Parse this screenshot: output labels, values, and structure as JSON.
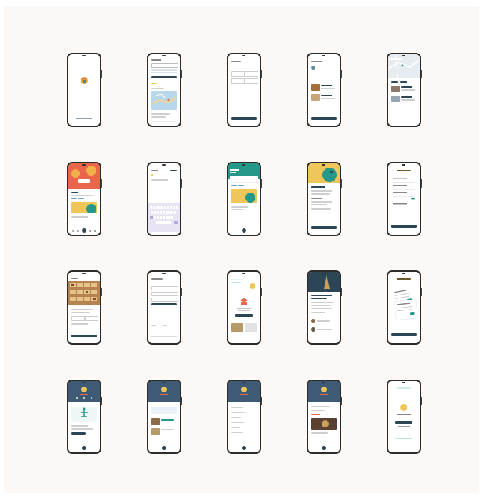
{
  "screens": [
    {
      "id": "splash",
      "row": 1,
      "col": 1,
      "text": "Echoes"
    },
    {
      "id": "map-explore",
      "row": 1,
      "col": 2
    },
    {
      "id": "filter-options",
      "row": 1,
      "col": 3
    },
    {
      "id": "place-list",
      "row": 1,
      "col": 4
    },
    {
      "id": "map-results",
      "row": 1,
      "col": 5
    },
    {
      "id": "festival-home",
      "row": 2,
      "col": 1
    },
    {
      "id": "keyboard-search",
      "row": 2,
      "col": 2
    },
    {
      "id": "featured-home",
      "row": 2,
      "col": 3
    },
    {
      "id": "place-detail",
      "row": 2,
      "col": 4
    },
    {
      "id": "ticket-form",
      "row": 2,
      "col": 5
    },
    {
      "id": "gallery-detail",
      "row": 3,
      "col": 1
    },
    {
      "id": "form-entry",
      "row": 3,
      "col": 2
    },
    {
      "id": "success-card",
      "row": 3,
      "col": 3
    },
    {
      "id": "story-article",
      "row": 3,
      "col": 4
    },
    {
      "id": "review-cards",
      "row": 3,
      "col": 5
    },
    {
      "id": "profile-badge",
      "row": 4,
      "col": 1
    },
    {
      "id": "profile-saved",
      "row": 4,
      "col": 2
    },
    {
      "id": "profile-settings",
      "row": 4,
      "col": 3
    },
    {
      "id": "profile-activity",
      "row": 4,
      "col": 4
    },
    {
      "id": "profile-popup",
      "row": 4,
      "col": 5
    }
  ],
  "colors": {
    "board": "#fbf8f6",
    "navy": "#2d4656",
    "teal": "#26988a",
    "gold": "#eec65a",
    "coral": "#e9664a",
    "frame": "#2c2c2c"
  }
}
